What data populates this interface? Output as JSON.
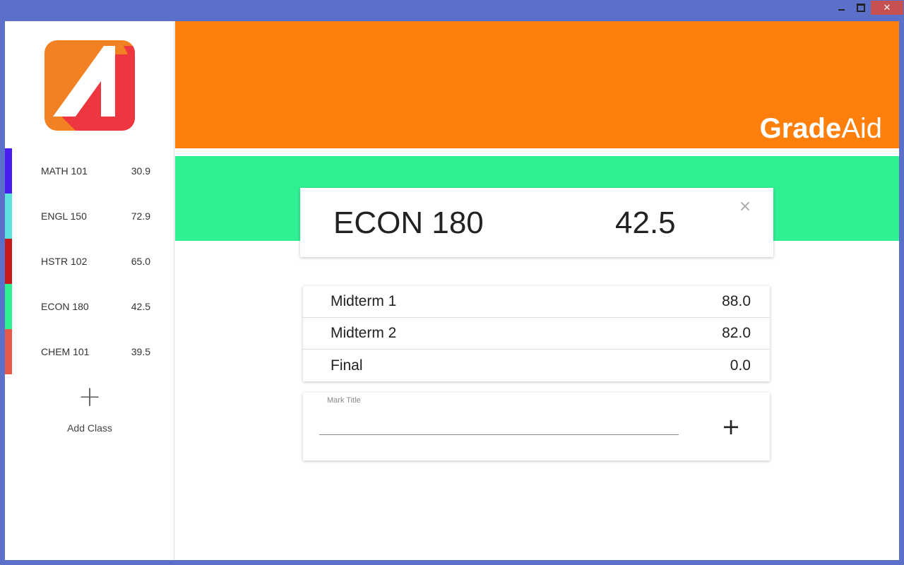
{
  "window": {
    "minimize_icon": "minimize-icon",
    "maximize_icon": "maximize-icon",
    "close_label": "✕"
  },
  "sidebar": {
    "logo_icon": "gradeaid-logo",
    "classes": [
      {
        "name": "MATH 101",
        "grade": "30.9",
        "color": "#4a1ef0"
      },
      {
        "name": "ENGL 150",
        "grade": "72.9",
        "color": "#5de0e0"
      },
      {
        "name": "HSTR 102",
        "grade": "65.0",
        "color": "#c81a1a"
      },
      {
        "name": "ECON 180",
        "grade": "42.5",
        "color": "#2ff093"
      },
      {
        "name": "CHEM 101",
        "grade": "39.5",
        "color": "#e8594a"
      }
    ],
    "add_class": {
      "icon": "plus-icon",
      "label": "Add Class"
    }
  },
  "header": {
    "brand_bold": "Grade",
    "brand_light": "Aid",
    "color": "#fe7f0b"
  },
  "selected_class": {
    "name": "ECON 180",
    "grade": "42.5",
    "band_color": "#2ff093",
    "close_icon": "close-icon",
    "close_glyph": "×"
  },
  "marks": [
    {
      "title": "Midterm 1",
      "value": "88.0"
    },
    {
      "title": "Midterm 2",
      "value": "82.0"
    },
    {
      "title": "Final",
      "value": "0.0"
    }
  ],
  "add_mark": {
    "label": "Mark Title",
    "value": "",
    "button_icon": "plus-icon",
    "button_glyph": "+"
  }
}
